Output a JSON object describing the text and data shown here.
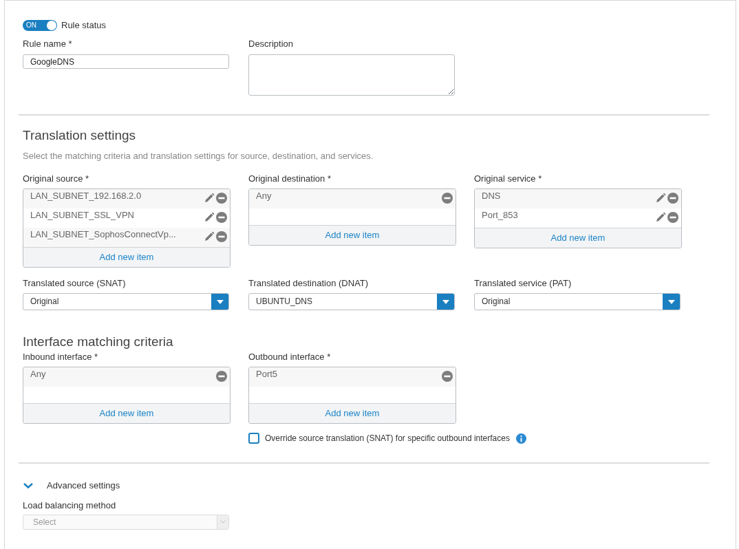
{
  "rule_status": {
    "toggle_text": "ON",
    "on": true,
    "label": "Rule status"
  },
  "rule_name": {
    "label": "Rule name *",
    "value": "GoogleDNS"
  },
  "description": {
    "label": "Description"
  },
  "translation": {
    "title": "Translation settings",
    "subtitle": "Select the matching criteria and translation settings for source, destination, and services.",
    "lists": [
      {
        "label": "Original source *",
        "items": [
          {
            "text": "LAN_SUBNET_192.168.2.0",
            "editable": true
          },
          {
            "text": "LAN_SUBNET_SSL_VPN",
            "editable": true
          },
          {
            "text": "LAN_SUBNET_SophosConnectVp...",
            "editable": true
          }
        ],
        "add": "Add new item"
      },
      {
        "label": "Original destination *",
        "items": [
          {
            "text": "Any",
            "editable": false
          }
        ],
        "add": "Add new item"
      },
      {
        "label": "Original service *",
        "items": [
          {
            "text": "DNS",
            "editable": true
          },
          {
            "text": "Port_853",
            "editable": true
          }
        ],
        "add": "Add new item"
      }
    ],
    "selects": [
      {
        "label": "Translated source (SNAT)",
        "value": "Original"
      },
      {
        "label": "Translated destination (DNAT)",
        "value": "UBUNTU_DNS"
      },
      {
        "label": "Translated service (PAT)",
        "value": "Original"
      }
    ]
  },
  "interface": {
    "title": "Interface matching criteria",
    "lists": [
      {
        "label": "Inbound interface *",
        "items": [
          {
            "text": "Any",
            "editable": false
          }
        ],
        "add": "Add new item"
      },
      {
        "label": "Outbound interface *",
        "items": [
          {
            "text": "Port5",
            "editable": false
          }
        ],
        "add": "Add new item"
      }
    ],
    "override": {
      "label": "Override source translation (SNAT) for specific outbound interfaces",
      "checked": false
    }
  },
  "advanced": {
    "label": "Advanced settings",
    "expanded": true,
    "load_balancing": {
      "label": "Load balancing method",
      "placeholder": "Select",
      "disabled": true
    }
  }
}
